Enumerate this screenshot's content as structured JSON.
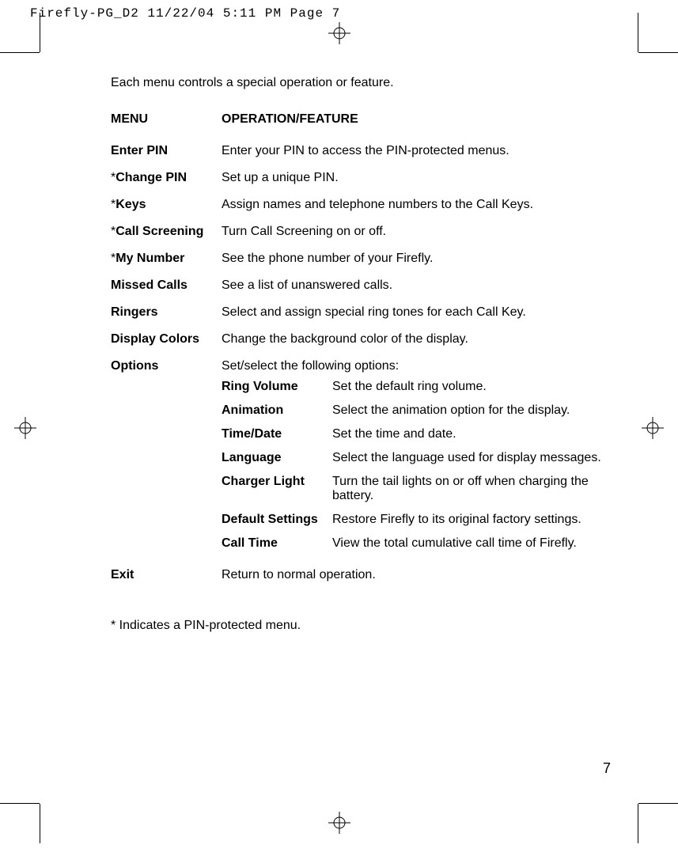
{
  "slug": "Firefly-PG_D2  11/22/04  5:11 PM  Page 7",
  "intro": "Each menu controls a special operation or feature.",
  "headers": {
    "menu": "MENU",
    "feature": "OPERATION/FEATURE"
  },
  "rows": [
    {
      "menu": "Enter PIN",
      "star": false,
      "desc": "Enter your PIN to access the PIN-protected menus."
    },
    {
      "menu": "Change PIN",
      "star": true,
      "desc": "Set up a unique PIN."
    },
    {
      "menu": "Keys",
      "star": true,
      "desc": "Assign names and telephone numbers to the Call Keys."
    },
    {
      "menu": "Call Screening",
      "star": true,
      "desc": "Turn Call Screening on or off."
    },
    {
      "menu": "My Number",
      "star": true,
      "desc": "See the phone number of your Firefly."
    },
    {
      "menu": "Missed Calls",
      "star": false,
      "desc": "See a list of unanswered calls."
    },
    {
      "menu": "Ringers",
      "star": false,
      "desc": "Select and assign special ring tones for each Call Key."
    },
    {
      "menu": "Display Colors",
      "star": false,
      "desc": "Change the background color of the display."
    },
    {
      "menu": "Options",
      "star": false,
      "desc": "Set/select the following options:"
    }
  ],
  "options_sub": [
    {
      "name": "Ring Volume",
      "desc": "Set the default ring volume."
    },
    {
      "name": "Animation",
      "desc": "Select the animation option for the display."
    },
    {
      "name": "Time/Date",
      "desc": "Set the time and date."
    },
    {
      "name": "Language",
      "desc": "Select the language used for display messages."
    },
    {
      "name": "Charger Light",
      "desc": "Turn the tail lights on or off when charging the battery."
    },
    {
      "name": "Default Settings",
      "desc": "Restore Firefly to its original factory settings."
    },
    {
      "name": "Call Time",
      "desc": "View the total cumulative call time of Firefly."
    }
  ],
  "exit_row": {
    "menu": "Exit",
    "desc": "Return to normal operation."
  },
  "footnote": "* Indicates a PIN-protected menu.",
  "page_number": "7"
}
